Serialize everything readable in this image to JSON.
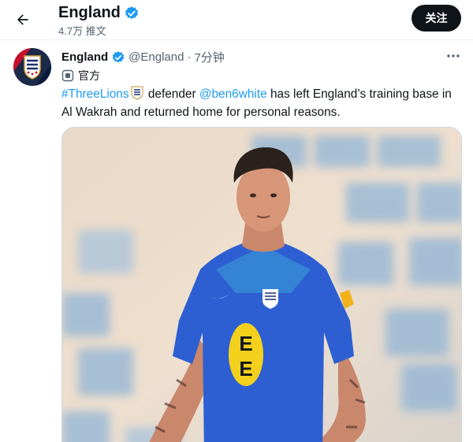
{
  "header": {
    "title": "England",
    "subtitle": "4.7万 推文",
    "follow_label": "关注"
  },
  "tweet": {
    "author_name": "England",
    "handle": "@England",
    "separator": "·",
    "time": "7分钟",
    "label": "官方",
    "text": {
      "hashtag": "#ThreeLions",
      "part1": " defender ",
      "mention": "@ben6white",
      "part2": " has left England’s training base in Al Wakrah and returned home for personal reasons."
    },
    "media": {
      "shirt_logo_text_top": "E",
      "shirt_logo_text_bottom": "E"
    }
  },
  "colors": {
    "accent": "#1d9bf0",
    "verified": "#1d9bf0",
    "text": "#0f1419",
    "muted": "#536471",
    "shirt_blue": "#2d5fd3",
    "shirt_yellow": "#f2d01c"
  },
  "icons": {
    "back": "arrow-left-icon",
    "verified": "verified-badge-icon",
    "more": "more-horizontal-icon",
    "label": "official-label-icon",
    "flag": "england-crest-emoji"
  }
}
